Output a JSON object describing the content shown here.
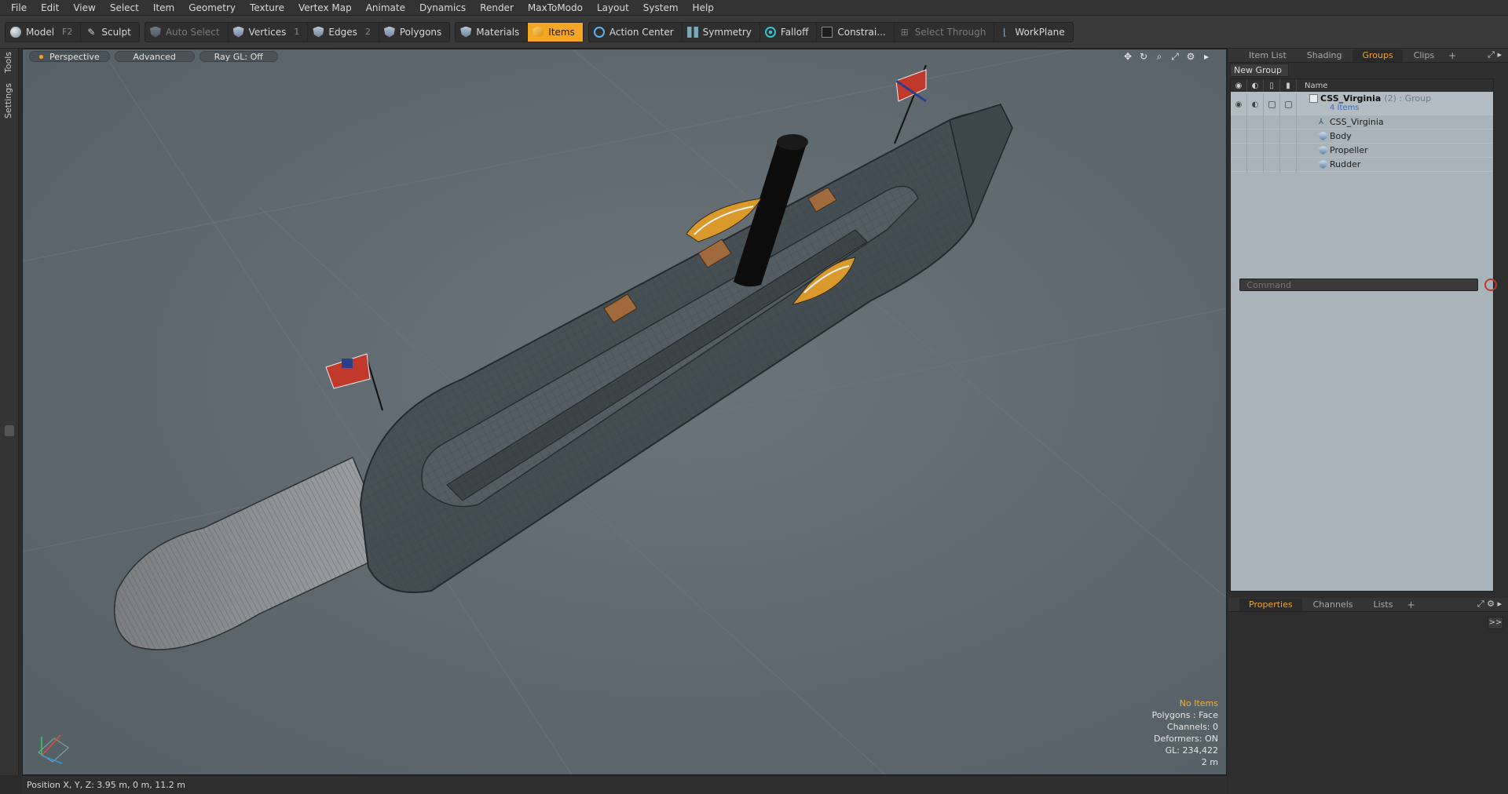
{
  "menu": [
    "File",
    "Edit",
    "View",
    "Select",
    "Item",
    "Geometry",
    "Texture",
    "Vertex Map",
    "Animate",
    "Dynamics",
    "Render",
    "MaxToModo",
    "Layout",
    "System",
    "Help"
  ],
  "toolbar": {
    "model": "Model",
    "model_key": "F2",
    "sculpt": "Sculpt",
    "auto_select": "Auto Select",
    "vertices": "Vertices",
    "vertices_key": "1",
    "edges": "Edges",
    "edges_key": "2",
    "polygons": "Polygons",
    "materials": "Materials",
    "items": "Items",
    "action_center": "Action Center",
    "symmetry": "Symmetry",
    "falloff": "Falloff",
    "constraints": "Constrai...",
    "select_through": "Select Through",
    "workplane": "WorkPlane",
    "accent": "#f5a623"
  },
  "left_tabs": [
    "Tools",
    "Settings"
  ],
  "viewport": {
    "view": "Perspective",
    "shading": "Advanced",
    "raygl": "Ray GL: Off",
    "info": {
      "selection": "No Items",
      "polygons": "Polygons : Face",
      "channels": "Channels: 0",
      "deformers": "Deformers: ON",
      "gl": "GL: 234,422",
      "scale": "2 m"
    }
  },
  "status": {
    "position": "Position X, Y, Z:  3.95 m, 0 m, 11.2 m"
  },
  "panel": {
    "tabs": [
      "Item List",
      "Shading",
      "Groups",
      "Clips"
    ],
    "active_tab": "Groups",
    "new_group": "New Group",
    "name_header": "Name",
    "group": {
      "name": "CSS_Virginia",
      "meta": "(2) : Group",
      "count": "4 Items"
    },
    "items": [
      "CSS_Virginia",
      "Body",
      "Propeller",
      "Rudder"
    ],
    "bottom_tabs": [
      "Properties",
      "Channels",
      "Lists"
    ],
    "command_placeholder": "Command",
    "expand": ">>"
  }
}
